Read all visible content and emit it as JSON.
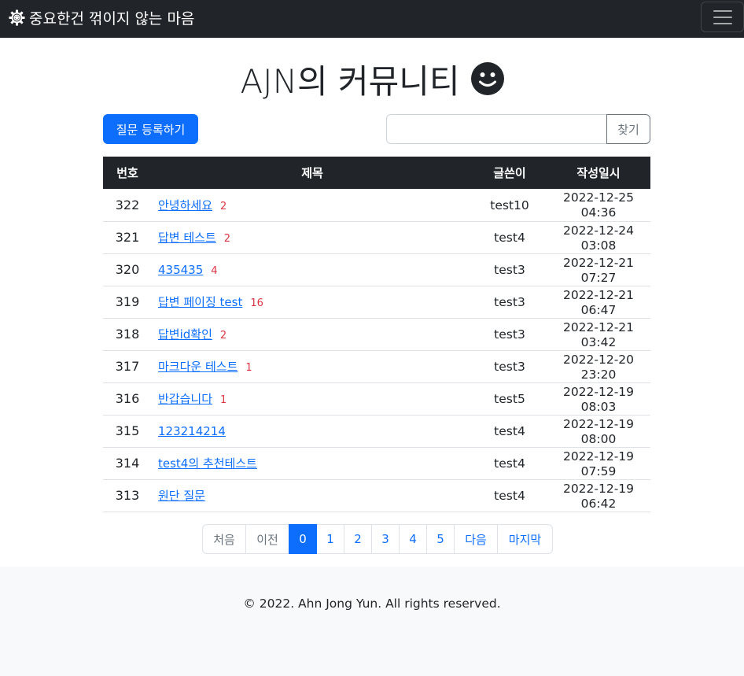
{
  "navbar": {
    "brand_icon": "gear-icon",
    "brand_text": "중요한건 꺾이지 않는 마음",
    "toggler_icon": "hamburger-menu-icon"
  },
  "header": {
    "title": "AJN의 커뮤니티",
    "emoji_icon": "smiley-face-icon"
  },
  "toolbar": {
    "register_label": "질문 등록하기",
    "search_value": "",
    "search_button_label": "찾기"
  },
  "table": {
    "columns": [
      "번호",
      "제목",
      "글쓴이",
      "작성일시"
    ],
    "rows": [
      {
        "no": "322",
        "title": "안녕하세요",
        "answers": "2",
        "author": "test10",
        "date": "2022-12-25 04:36"
      },
      {
        "no": "321",
        "title": "답변 테스트",
        "answers": "2",
        "author": "test4",
        "date": "2022-12-24 03:08"
      },
      {
        "no": "320",
        "title": "435435",
        "answers": "4",
        "author": "test3",
        "date": "2022-12-21 07:27"
      },
      {
        "no": "319",
        "title": "답변 페이징 test",
        "answers": "16",
        "author": "test3",
        "date": "2022-12-21 06:47"
      },
      {
        "no": "318",
        "title": "답변id확인",
        "answers": "2",
        "author": "test3",
        "date": "2022-12-21 03:42"
      },
      {
        "no": "317",
        "title": "마크다운 테스트",
        "answers": "1",
        "author": "test3",
        "date": "2022-12-20 23:20"
      },
      {
        "no": "316",
        "title": "반갑습니다",
        "answers": "1",
        "author": "test5",
        "date": "2022-12-19 08:03"
      },
      {
        "no": "315",
        "title": "123214214",
        "answers": "",
        "author": "test4",
        "date": "2022-12-19 08:00"
      },
      {
        "no": "314",
        "title": "test4의 추천테스트",
        "answers": "",
        "author": "test4",
        "date": "2022-12-19 07:59"
      },
      {
        "no": "313",
        "title": "원단 질문",
        "answers": "",
        "author": "test4",
        "date": "2022-12-19 06:42"
      }
    ]
  },
  "pagination": {
    "first": "처음",
    "prev": "이전",
    "pages": [
      "0",
      "1",
      "2",
      "3",
      "4",
      "5"
    ],
    "active_page": "0",
    "next": "다음",
    "last": "마지막"
  },
  "footer": {
    "text": "© 2022. Ahn Jong Yun. All rights reserved."
  },
  "colors": {
    "navbar_bg": "#212529",
    "primary": "#0d6efd",
    "answer_count": "#dc3545",
    "footer_bg": "#f8f9fa"
  }
}
